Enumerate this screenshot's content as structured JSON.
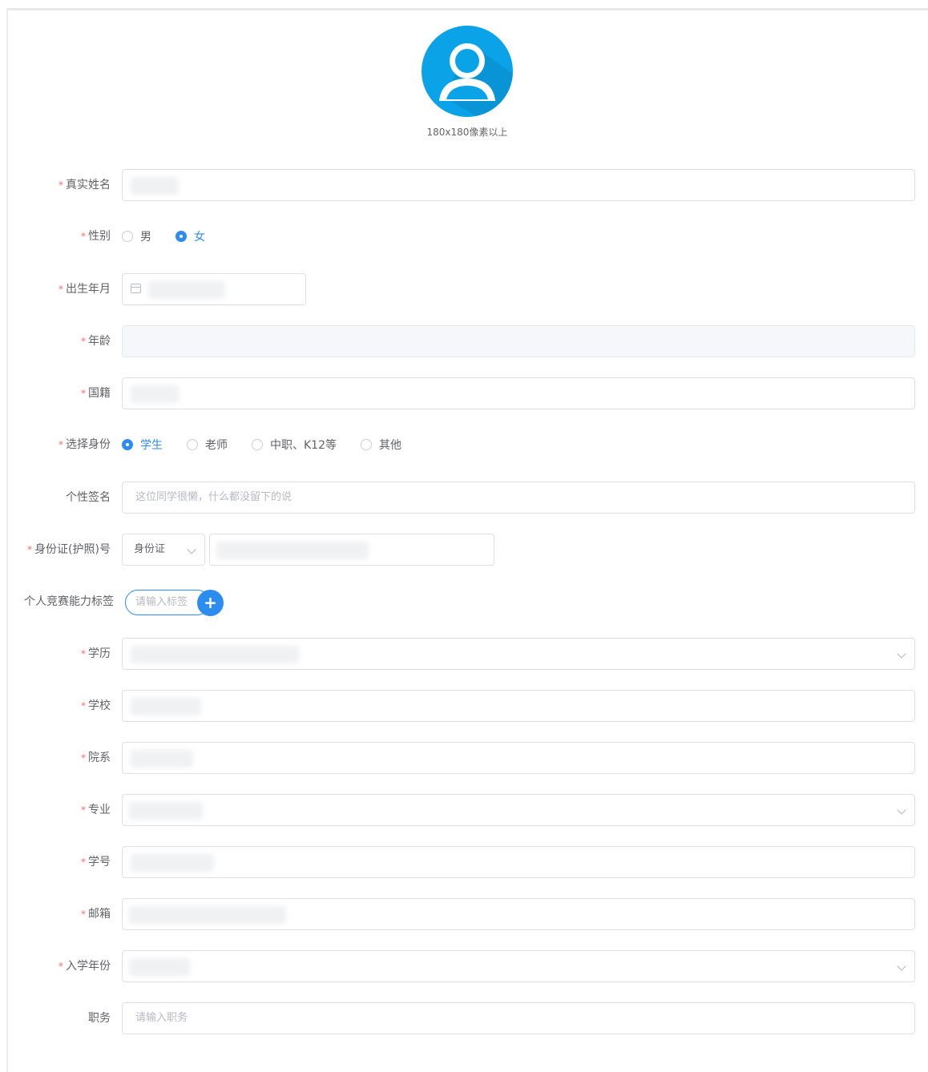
{
  "avatar": {
    "tip": "180x180像素以上",
    "icon": "user-avatar-icon",
    "color": "#0aa3e8"
  },
  "fields": {
    "real_name": {
      "label": "真实姓名",
      "required": "*"
    },
    "gender": {
      "label": "性别",
      "required": "*",
      "options": [
        "男",
        "女"
      ],
      "selected": "女"
    },
    "birth": {
      "label": "出生年月",
      "required": "*"
    },
    "age": {
      "label": "年龄",
      "required": "*"
    },
    "nationality": {
      "label": "国籍",
      "required": "*"
    },
    "identity": {
      "label": "选择身份",
      "required": "*",
      "options": [
        "学生",
        "老师",
        "中职、K12等",
        "其他"
      ],
      "selected": "学生"
    },
    "signature": {
      "label": "个性签名",
      "placeholder": "这位同学很懒，什么都没留下的说"
    },
    "id_number": {
      "label": "身份证(护照)号",
      "required": "*",
      "type_value": "身份证"
    },
    "tags": {
      "label": "个人竞赛能力标签",
      "placeholder": "请输入标签",
      "add": "+"
    },
    "education": {
      "label": "学历",
      "required": "*"
    },
    "school": {
      "label": "学校",
      "required": "*"
    },
    "department": {
      "label": "院系",
      "required": "*"
    },
    "major": {
      "label": "专业",
      "required": "*"
    },
    "student_no": {
      "label": "学号",
      "required": "*"
    },
    "email": {
      "label": "邮箱",
      "required": "*"
    },
    "enroll_year": {
      "label": "入学年份",
      "required": "*"
    },
    "position": {
      "label": "职务",
      "placeholder": "请输入职务"
    }
  },
  "colors": {
    "primary": "#2d8cf0",
    "required": "#f56c6c"
  }
}
